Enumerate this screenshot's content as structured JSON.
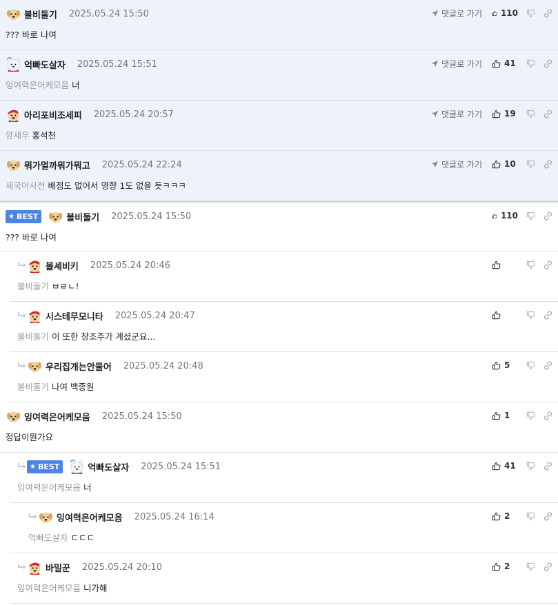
{
  "best_label": "BEST",
  "goto_label": "댓글로 가기",
  "colors": {
    "best_bg": "#eef3fb",
    "badge": "#4a86e8"
  },
  "best_comments": [
    {
      "nick": "불비둘기",
      "date": "2025.05.24 15:50",
      "mention": "",
      "text": "??? 바로 나여",
      "likes": "110",
      "avatar": "puppy-avatar"
    },
    {
      "nick": "억빠도살자",
      "date": "2025.05.24 15:51",
      "mention": "잉여력은어케모음",
      "text": "너",
      "likes": "41",
      "avatar": "polar-bear-avatar"
    },
    {
      "nick": "아리포비조세피",
      "date": "2025.05.24 20:57",
      "mention": "깡새우",
      "text": "홍석천",
      "likes": "19",
      "avatar": "puppy-santa-avatar"
    },
    {
      "nick": "뭐가멀까뭐가뭐고",
      "date": "2025.05.24 22:24",
      "mention": "새국어사전",
      "text": "배점도 없어서 영향 1도 없을 듯ㅋㅋㅋ",
      "likes": "10",
      "avatar": "puppy-avatar"
    }
  ],
  "comments": [
    {
      "nick": "불비둘기",
      "date": "2025.05.24 15:50",
      "mention": "",
      "text": "??? 바로 나여",
      "likes": "110",
      "best": true,
      "depth": 0,
      "avatar": "puppy-avatar"
    },
    {
      "nick": "볼셰비키",
      "date": "2025.05.24 20:46",
      "mention": "불비둘기",
      "text": "ㅂㄹㄴ!",
      "likes": "",
      "best": false,
      "depth": 1,
      "avatar": "puppy-santa-avatar"
    },
    {
      "nick": "시스테무모니타",
      "date": "2025.05.24 20:47",
      "mention": "불비둘기",
      "text": "이 또한 창조주가 계셨군요...",
      "likes": "",
      "best": false,
      "depth": 1,
      "avatar": "puppy-santa-avatar"
    },
    {
      "nick": "우리집개는안물어",
      "date": "2025.05.24 20:48",
      "mention": "불비둘기",
      "text": "나여 백종원",
      "likes": "5",
      "best": false,
      "depth": 1,
      "avatar": "puppy-avatar"
    },
    {
      "nick": "잉여력은어케모음",
      "date": "2025.05.24 15:50",
      "mention": "",
      "text": "정답이뭔가요",
      "likes": "1",
      "best": false,
      "depth": 0,
      "avatar": "puppy-avatar"
    },
    {
      "nick": "억빠도살자",
      "date": "2025.05.24 15:51",
      "mention": "잉여력은어케모음",
      "text": "너",
      "likes": "41",
      "best": true,
      "depth": 1,
      "avatar": "polar-bear-avatar"
    },
    {
      "nick": "잉여력은어케모음",
      "date": "2025.05.24 16:14",
      "mention": "억빠도살자",
      "text": "ㄷㄷㄷ",
      "likes": "2",
      "best": false,
      "depth": 2,
      "avatar": "puppy-avatar"
    },
    {
      "nick": "바밀꾼",
      "date": "2025.05.24 20:10",
      "mention": "잉여력은어케모음",
      "text": "니가해",
      "likes": "2",
      "best": false,
      "depth": 1,
      "avatar": "puppy-santa-avatar"
    }
  ]
}
